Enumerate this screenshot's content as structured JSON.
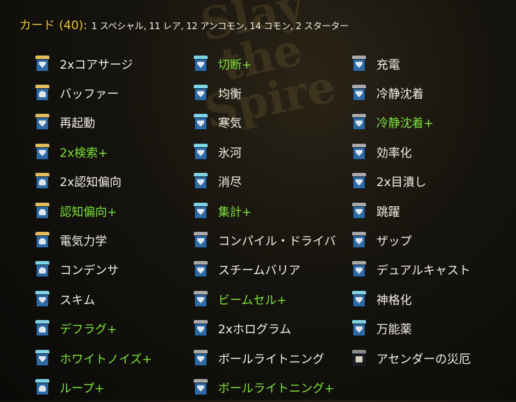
{
  "header": {
    "label": "カード",
    "count": "(40)",
    "colon": ":",
    "summary": "1 スペシャル, 11 レア, 12 アンコモン, 14 コモン, 2 スターター"
  },
  "background_logo_text": "Slay the Spire",
  "columns": [
    [
      {
        "name": "2xコアサージ",
        "upgraded": false,
        "rarity": "rare",
        "type": "skill"
      },
      {
        "name": "バッファー",
        "upgraded": false,
        "rarity": "rare",
        "type": "power"
      },
      {
        "name": "再起動",
        "upgraded": false,
        "rarity": "rare",
        "type": "skill"
      },
      {
        "name": "2x検索+",
        "upgraded": true,
        "rarity": "rare",
        "type": "skill"
      },
      {
        "name": "2x認知偏向",
        "upgraded": false,
        "rarity": "rare",
        "type": "power"
      },
      {
        "name": "認知偏向+",
        "upgraded": true,
        "rarity": "rare",
        "type": "power"
      },
      {
        "name": "電気力学",
        "upgraded": false,
        "rarity": "rare",
        "type": "power"
      },
      {
        "name": "コンデンサ",
        "upgraded": false,
        "rarity": "uncommon",
        "type": "power"
      },
      {
        "name": "スキム",
        "upgraded": false,
        "rarity": "uncommon",
        "type": "skill"
      },
      {
        "name": "デフラグ+",
        "upgraded": true,
        "rarity": "uncommon",
        "type": "power"
      },
      {
        "name": "ホワイトノイズ+",
        "upgraded": true,
        "rarity": "uncommon",
        "type": "skill"
      },
      {
        "name": "ループ+",
        "upgraded": true,
        "rarity": "uncommon",
        "type": "power"
      }
    ],
    [
      {
        "name": "切断+",
        "upgraded": true,
        "rarity": "uncommon",
        "type": "skill"
      },
      {
        "name": "均衡",
        "upgraded": false,
        "rarity": "uncommon",
        "type": "skill"
      },
      {
        "name": "寒気",
        "upgraded": false,
        "rarity": "uncommon",
        "type": "skill"
      },
      {
        "name": "氷河",
        "upgraded": false,
        "rarity": "uncommon",
        "type": "skill"
      },
      {
        "name": "消尽",
        "upgraded": false,
        "rarity": "uncommon",
        "type": "skill"
      },
      {
        "name": "集計+",
        "upgraded": true,
        "rarity": "uncommon",
        "type": "skill"
      },
      {
        "name": "コンパイル・ドライバ",
        "upgraded": false,
        "rarity": "common",
        "type": "skill"
      },
      {
        "name": "スチームバリア",
        "upgraded": false,
        "rarity": "common",
        "type": "skill"
      },
      {
        "name": "ビームセル+",
        "upgraded": true,
        "rarity": "common",
        "type": "skill"
      },
      {
        "name": "2xホログラム",
        "upgraded": false,
        "rarity": "common",
        "type": "skill"
      },
      {
        "name": "ボールライトニング",
        "upgraded": false,
        "rarity": "common",
        "type": "skill"
      },
      {
        "name": "ボールライトニング+",
        "upgraded": true,
        "rarity": "common",
        "type": "skill"
      }
    ],
    [
      {
        "name": "充電",
        "upgraded": false,
        "rarity": "common",
        "type": "skill"
      },
      {
        "name": "冷静沈着",
        "upgraded": false,
        "rarity": "common",
        "type": "skill"
      },
      {
        "name": "冷静沈着+",
        "upgraded": true,
        "rarity": "common",
        "type": "skill"
      },
      {
        "name": "効率化",
        "upgraded": false,
        "rarity": "common",
        "type": "skill"
      },
      {
        "name": "2x目潰し",
        "upgraded": false,
        "rarity": "common",
        "type": "skill"
      },
      {
        "name": "跳躍",
        "upgraded": false,
        "rarity": "common",
        "type": "skill"
      },
      {
        "name": "ザップ",
        "upgraded": false,
        "rarity": "starter",
        "type": "skill"
      },
      {
        "name": "デュアルキャスト",
        "upgraded": false,
        "rarity": "starter",
        "type": "skill"
      },
      {
        "name": "神格化",
        "upgraded": false,
        "rarity": "special",
        "type": "skill"
      },
      {
        "name": "万能薬",
        "upgraded": false,
        "rarity": "special",
        "type": "skill"
      },
      {
        "name": "アセンダーの災厄",
        "upgraded": false,
        "rarity": "curse",
        "type": "curse"
      }
    ]
  ]
}
